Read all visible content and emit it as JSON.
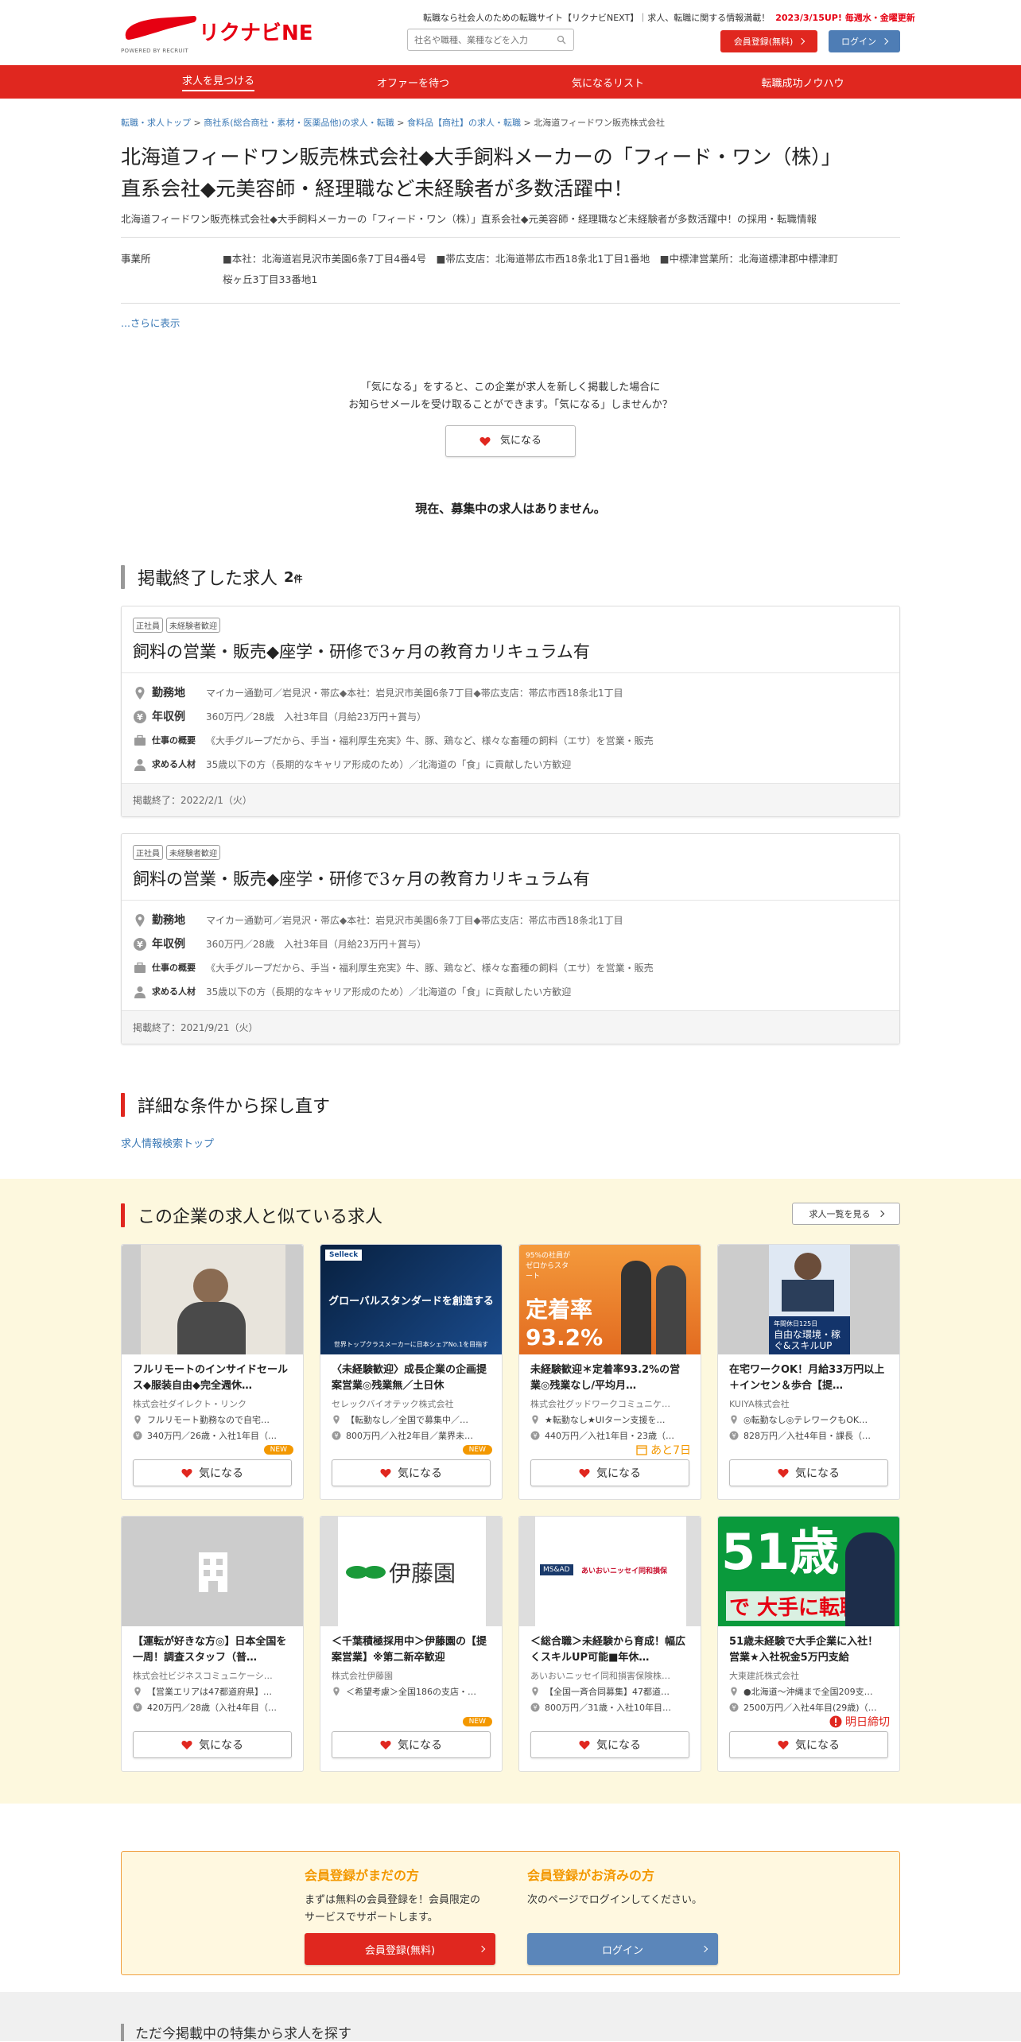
{
  "header": {
    "logo_text": "リクナビNEXT",
    "logo_sub": "POWERED BY RECRUIT",
    "tagline": "転職なら社会人のための転職サイト【リクナビNEXT】｜求人、転職に関する情報満載！",
    "update_note": "2023/3/15UP! 毎週水・金曜更新",
    "search_placeholder": "社名や職種、業種などを入力",
    "register_label": "会員登録(無料)",
    "login_label": "ログイン"
  },
  "nav": {
    "items": [
      "求人を見つける",
      "オファーを待つ",
      "気になるリスト",
      "転職成功ノウハウ"
    ]
  },
  "breadcrumb": [
    "転職・求人トップ",
    "商社系(総合商社・素材・医薬品他)の求人・転職",
    "食料品【商社】の求人・転職",
    "北海道フィードワン販売株式会社"
  ],
  "company": {
    "title_line1": "北海道フィードワン販売株式会社◆大手飼料メーカーの「フィード・ワン（株）」",
    "title_line2": "直系会社◆元美容師・経理職など未経験者が多数活躍中！",
    "lead": "北海道フィードワン販売株式会社◆大手飼料メーカーの「フィード・ワン（株）」直系会社◆元美容師・経理職など未経験者が多数活躍中！の採用・転職情報",
    "office_label": "事業所",
    "office_line1": "■本社：北海道岩見沢市美園6条7丁目4番4号　■帯広支店：北海道帯広市西18条北1丁目1番地　■中標津営業所：北海道標津郡中標津町",
    "office_line2": "桜ヶ丘3丁目33番地1",
    "more": "...さらに表示"
  },
  "fav_prompt": {
    "line1": "「気になる」をすると、この企業が求人を新しく掲載した場合に",
    "line2": "お知らせメールを受け取ることができます。「気になる」しませんか？",
    "button": "気になる"
  },
  "no_jobs": "現在、募集中の求人はありません。",
  "ended": {
    "title": "掲載終了した求人",
    "count": "2",
    "count_unit": "件",
    "jobs": [
      {
        "tags": [
          "正社員",
          "未経験者歓迎"
        ],
        "title": "飼料の営業・販売◆座学・研修で3ヶ月の教育カリキュラム有",
        "loc_label": "勤務地",
        "loc": "マイカー通勤可／岩見沢・帯広◆本社：岩見沢市美園6条7丁目◆帯広支店：帯広市西18条北1丁目",
        "pay_label": "年収例",
        "pay": "360万円／28歳　入社3年目（月給23万円＋賞与）",
        "desc_label": "仕事の概要",
        "desc": "《大手グループだから、手当・福利厚生充実》牛、豚、鶏など、様々な畜種の飼料（エサ）を営業・販売",
        "req_label": "求める人材",
        "req": "35歳以下の方（長期的なキャリア形成のため）／北海道の「食」に貢献したい方歓迎",
        "end": "掲載終了：2022/2/1（火）"
      },
      {
        "tags": [
          "正社員",
          "未経験者歓迎"
        ],
        "title": "飼料の営業・販売◆座学・研修で3ヶ月の教育カリキュラム有",
        "loc_label": "勤務地",
        "loc": "マイカー通勤可／岩見沢・帯広◆本社：岩見沢市美園6条7丁目◆帯広支店：帯広市西18条北1丁目",
        "pay_label": "年収例",
        "pay": "360万円／28歳　入社3年目（月給23万円＋賞与）",
        "desc_label": "仕事の概要",
        "desc": "《大手グループだから、手当・福利厚生充実》牛、豚、鶏など、様々な畜種の飼料（エサ）を営業・販売",
        "req_label": "求める人材",
        "req": "35歳以下の方（長期的なキャリア形成のため）／北海道の「食」に貢献したい方歓迎",
        "end": "掲載終了：2021/9/21（火）"
      }
    ]
  },
  "retry": {
    "title": "詳細な条件から探し直す",
    "link": "求人情報検索トップ"
  },
  "similar": {
    "title": "この企業の求人と似ている求人",
    "list_button": "求人一覧を見る",
    "fav_label": "気になる",
    "jobs": [
      {
        "title": "フルリモートのインサイドセールス◆服装自由◆完全週休…",
        "company": "株式会社ダイレクト・リンク",
        "loc": "フルリモート勤務なので自宅…",
        "pay": "340万円／26歳・入社1年目（…",
        "badge": "NEW",
        "img": "photo-person"
      },
      {
        "title": "〈未経験歓迎〉成長企業の企画提案営業◎残業無／土日休",
        "company": "セレックバイオテック株式会社",
        "loc": "【転勤なし／全国で募集中／…",
        "pay": "800万円／入社2年目／業界未…",
        "badge": "NEW",
        "img": "global-standard",
        "img_text": "グローバルスタンダードを創造する",
        "img_sub": "世界トップクラスメーカーに日本シェアNo.1を目指す",
        "img_logo": "Selleck"
      },
      {
        "title": "未経験歓迎＊定着率93.2%の営業◎残業なし/平均月…",
        "company": "株式会社グッドワークコミュニケ…",
        "loc": "★転勤なし★UIターン支援を…",
        "pay": "440万円／入社1年目・23歳（…",
        "badge": "あと7日",
        "img": "teichaku",
        "img_text": "定着率93.2%",
        "img_sub": "95%の社員がゼロからスタート"
      },
      {
        "title": "在宅ワークOK！月給33万円以上＋インセン＆歩合【提…",
        "company": "KUIYA株式会社",
        "loc": "◎転勤なし◎テレワークもOK…",
        "pay": "828万円／入社4年目・課長（…",
        "badge": "",
        "img": "office-phone",
        "img_text": "自由な環境・稼ぐ&スキルUP",
        "img_sub": "年間休日125日"
      },
      {
        "title": "【運転が好きな方◎】日本全国を一周！調査スタッフ（普…",
        "company": "株式会社ビジネスコミュニケーシ…",
        "loc": "【営業エリアは47都道府県】…",
        "pay": "420万円／28歳（入社4年目（…",
        "badge": "",
        "img": "building-placeholder"
      },
      {
        "title": "＜千葉積極採用中＞伊藤園の【提案営業】※第二新卒歓迎",
        "company": "株式会社伊藤園",
        "loc": "＜希望考慮＞全国186の支店・…",
        "pay": "",
        "badge": "NEW",
        "img": "itoen",
        "img_text": "伊藤園"
      },
      {
        "title": "＜総合職＞未経験から育成！幅広くスキルUP可能■年休…",
        "company": "あいおいニッセイ同和損害保険株…",
        "loc": "【全国一斉合同募集】47都道…",
        "pay": "800万円／31歳・入社10年目…",
        "badge": "",
        "img": "aioi",
        "img_text": "あいおいニッセイ同和損保",
        "img_logo": "MS&AD"
      },
      {
        "title": "51歳未経験で大手企業に入社！営業★入社祝金5万円支給",
        "company": "大東建託株式会社",
        "loc": "●北海道～沖縄まで全国209支…",
        "pay": "2500万円／入社4年目(29歳)（…",
        "badge": "明日締切",
        "img": "age51",
        "img_text": "51歳",
        "img_sub": "で 大手に転職!"
      }
    ]
  },
  "register": {
    "not_member_title": "会員登録がまだの方",
    "not_member_text1": "まずは無料の会員登録を！会員限定の",
    "not_member_text2": "サービスでサポートします。",
    "not_member_button": "会員登録(無料)",
    "member_title": "会員登録がお済みの方",
    "member_text": "次のページでログインしてください。",
    "member_button": "ログイン"
  },
  "feature_title": "ただ今掲載中の特集から求人を探す",
  "colors": {
    "brand_red": "#e0271f",
    "login_blue": "#4e7db5",
    "orange": "#f39800",
    "similar_bg": "#fdf8de"
  }
}
